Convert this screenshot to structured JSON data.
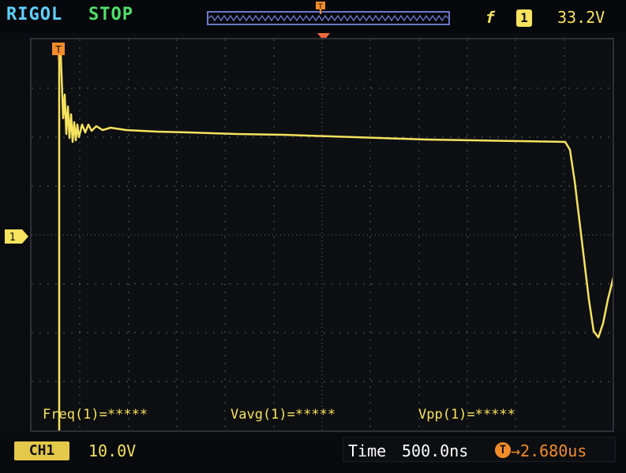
{
  "header": {
    "brand": "RIGOL",
    "run_state": "STOP",
    "trigger_edge_symbol": "f",
    "trigger_source": "1",
    "trigger_level": "33.2V"
  },
  "screen": {
    "channel_marker": "1",
    "trigger_marker": "T",
    "measurements": [
      {
        "label": "Freq(1)=*****"
      },
      {
        "label": "Vavg(1)=*****"
      },
      {
        "label": "Vpp(1)=*****"
      }
    ]
  },
  "footer": {
    "channel": "CH1",
    "volts_per_div": "10.0V",
    "time_label": "Time",
    "time_per_div": "500.0ns",
    "trigger_delay_icon": "T",
    "trigger_delay": "2.680us"
  },
  "colors": {
    "trace": "#f6e35e",
    "grid": "#5a5c63",
    "brand": "#5fd0ff",
    "run_state": "#4fe06a"
  }
}
